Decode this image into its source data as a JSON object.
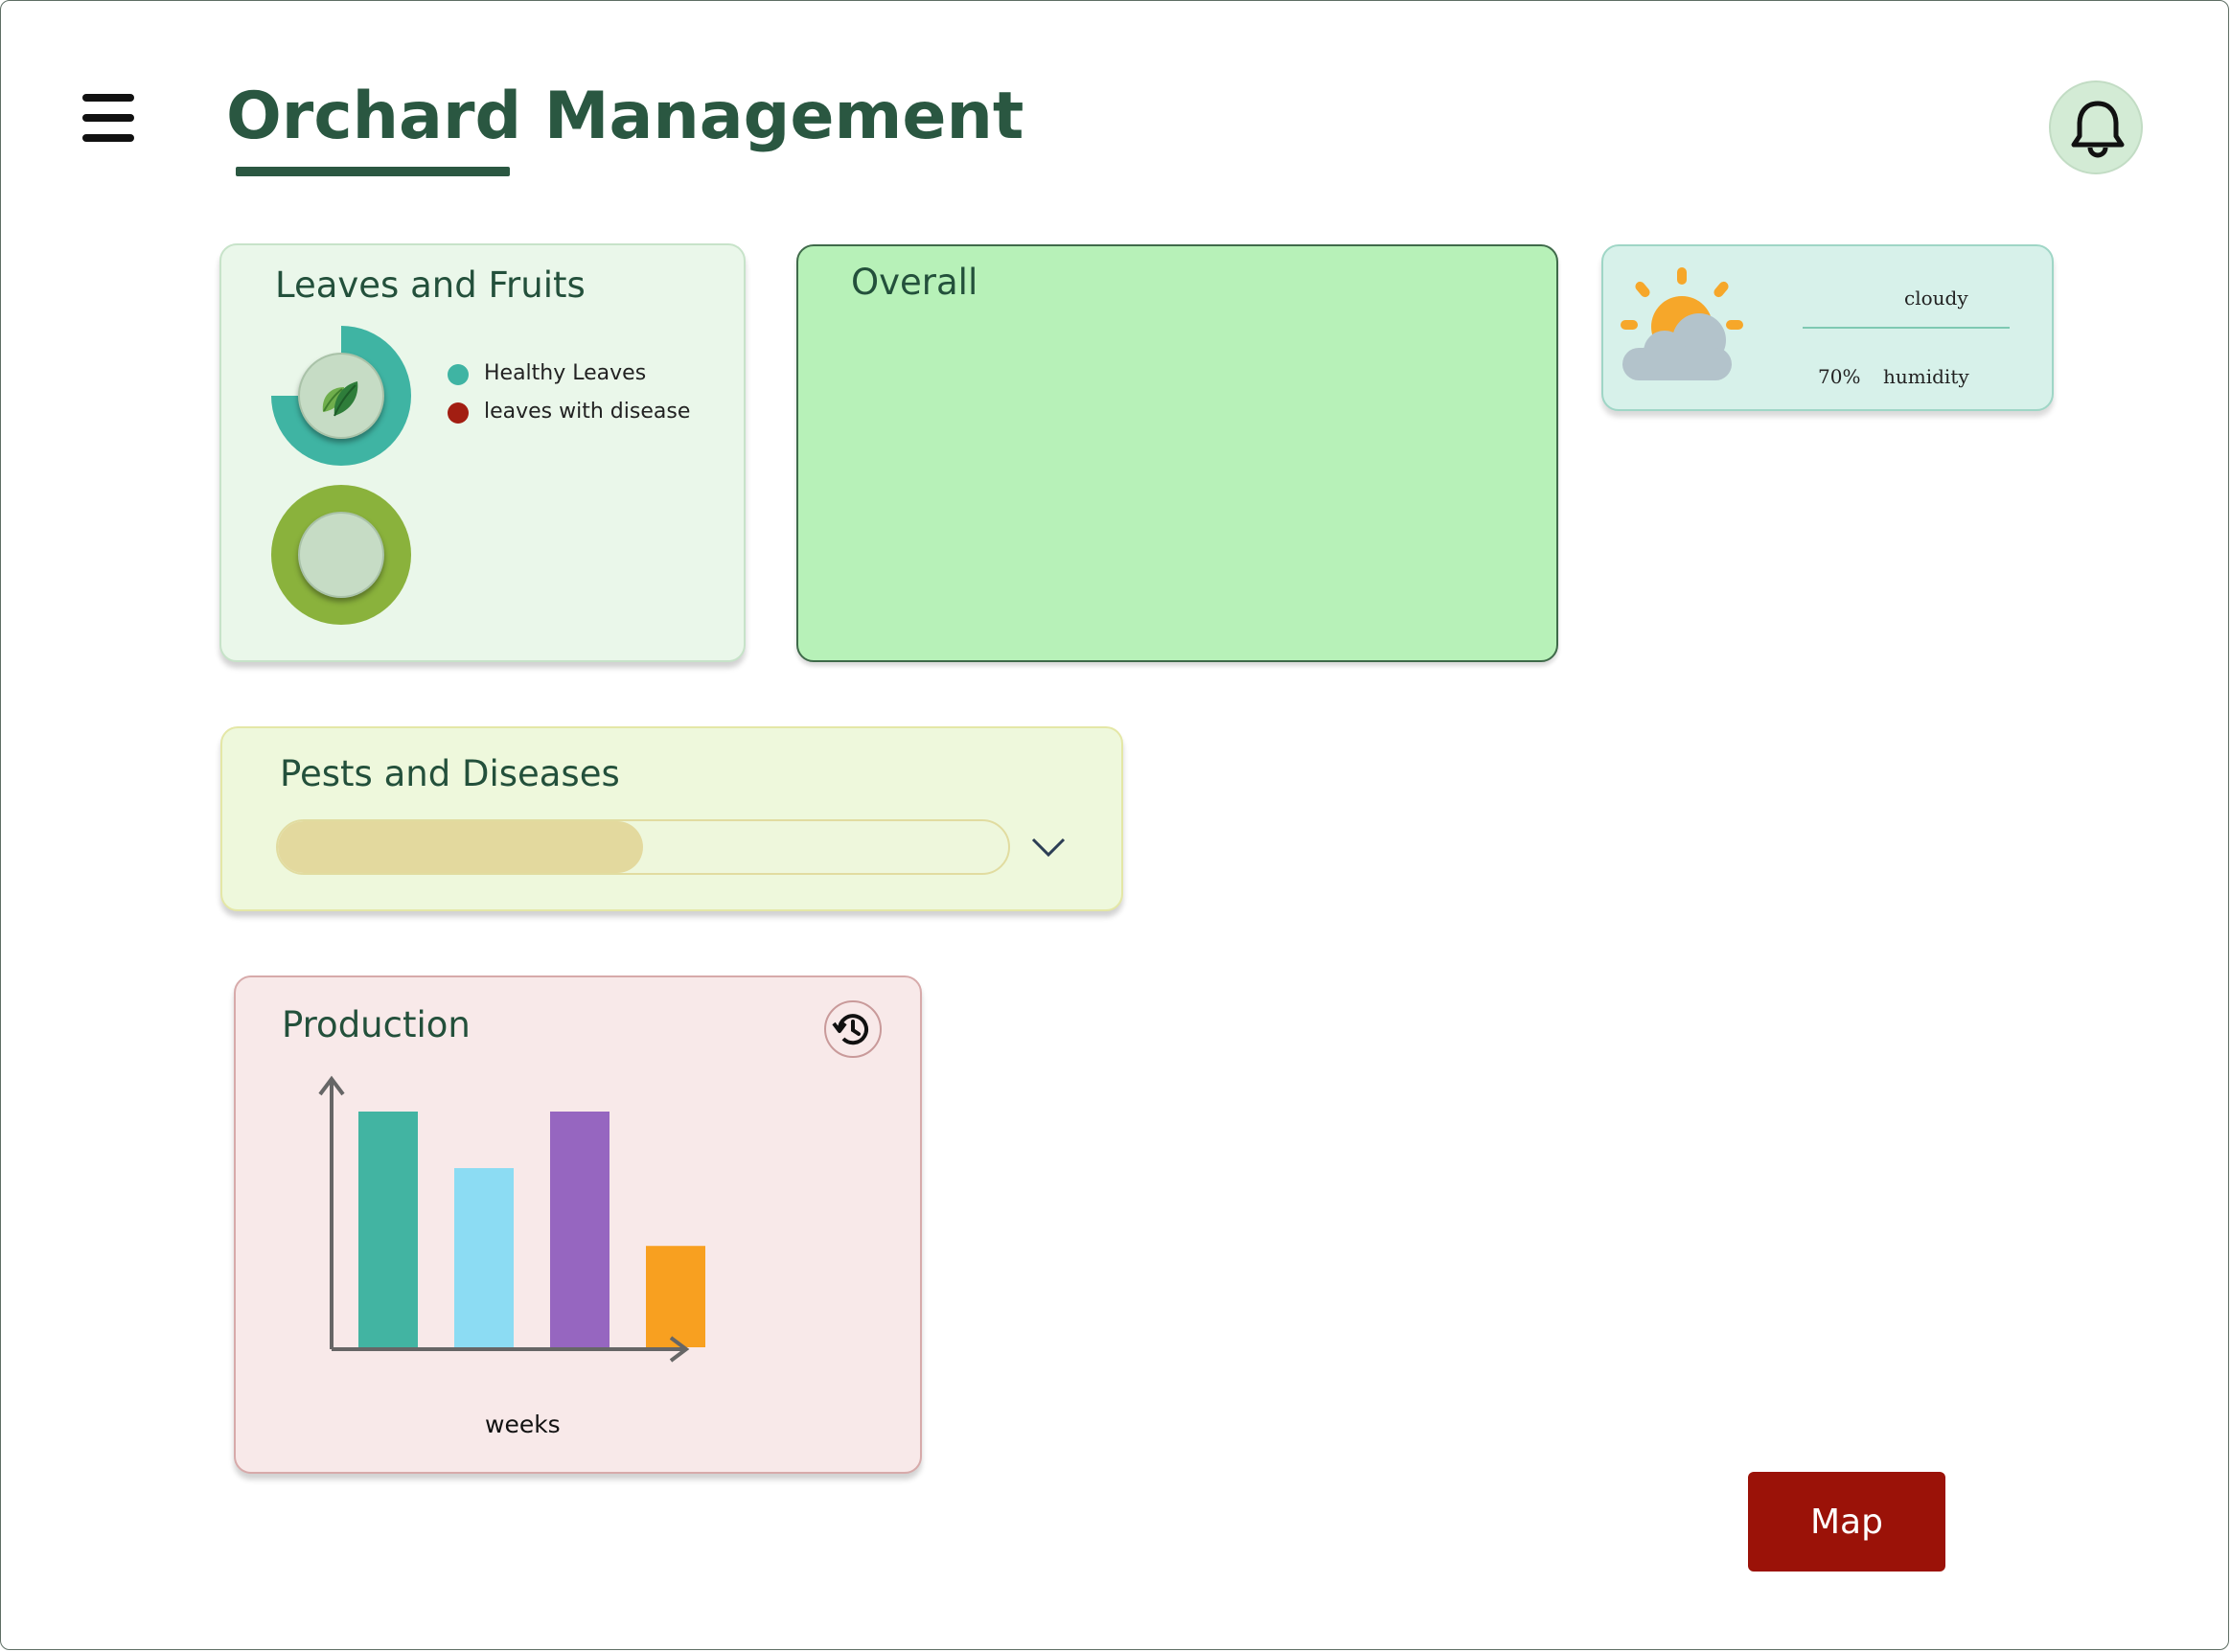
{
  "header": {
    "title": "Orchard Management"
  },
  "leaves_card": {
    "title": "Leaves and Fruits",
    "legend": [
      {
        "label": "Healthy Leaves",
        "color": "#3fb4a3"
      },
      {
        "label": "leaves with disease",
        "color": "#a21e12"
      }
    ],
    "leaves_ring": {
      "healthy_fraction": 0.75,
      "color": "#3fb4a3"
    },
    "fruits_ring": {
      "color": "#8ab23c"
    }
  },
  "overall_card": {
    "title": "Overall"
  },
  "weather_card": {
    "condition": "cloudy",
    "humidity_value": "70%",
    "humidity_label": "humidity"
  },
  "pests_card": {
    "title": "Pests and Diseases",
    "level_fraction": 0.5
  },
  "production_card": {
    "title": "Production",
    "chart_data": {
      "type": "bar",
      "xlabel": "weeks",
      "ylabel": "",
      "values": [
        100,
        76,
        100,
        43
      ],
      "colors": [
        "#42b4a2",
        "#8cdcf3",
        "#9666c0",
        "#f8a020"
      ]
    }
  },
  "actions": {
    "map_label": "Map"
  }
}
